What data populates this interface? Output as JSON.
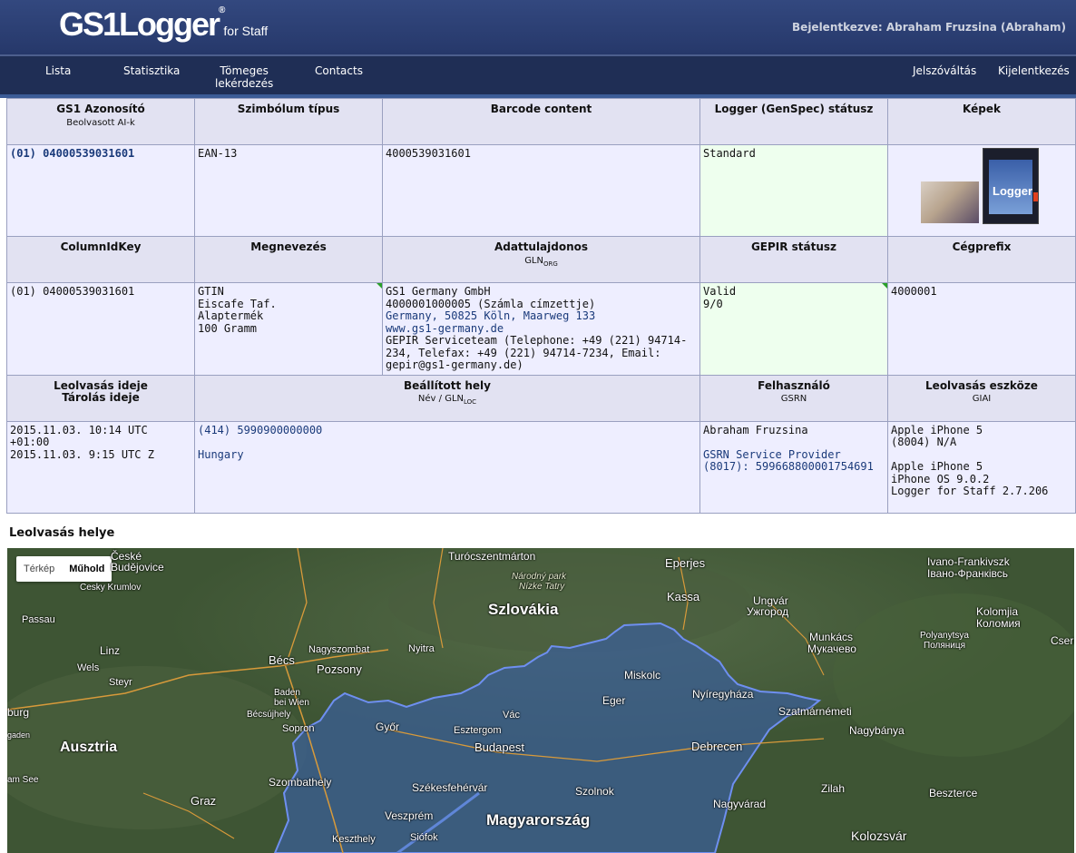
{
  "header": {
    "logo_main": "GS1Logger",
    "logo_reg": "®",
    "logo_sub": "for Staff",
    "user_text": "Bejelentkezve: Abraham Fruzsina (Abraham)"
  },
  "nav": {
    "lista": "Lista",
    "statisztika": "Statisztika",
    "tomeges_1": "Tömeges",
    "tomeges_2": "lekérdezés",
    "contacts": "Contacts",
    "jelszo": "Jelszóváltás",
    "kijelentkezes": "Kijelentkezés"
  },
  "table": {
    "h1": {
      "gs1": "GS1 Azonosító",
      "gs1_sub": "Beolvasott AI-k",
      "szimbolum": "Szimbólum típus",
      "barcode": "Barcode content",
      "logger": "Logger (GenSpec) státusz",
      "kepek": "Képek"
    },
    "r1": {
      "gs1": "(01) 04000539031601",
      "szimbolum": "EAN-13",
      "barcode": "4000539031601",
      "logger": "Standard"
    },
    "h2": {
      "columnid": "ColumnIdKey",
      "megnevezes": "Megnevezés",
      "adattulajdonos": "Adattulajdonos",
      "gln": "GLN",
      "gln_sub": "ORG",
      "gepir": "GEPIR státusz",
      "cegprefix": "Cégprefix"
    },
    "r2": {
      "columnid": "(01) 04000539031601",
      "megnevezes": [
        "GTIN",
        "Eiscafe Taf.",
        "Alaptermék",
        "100 Gramm"
      ],
      "owner_name": "GS1 Germany GmbH",
      "owner_gln": "4000001000005 (Számla címzettje)",
      "owner_addr": "Germany, 50825 Köln, Maarweg 133",
      "owner_web": "www.gs1-germany.de",
      "owner_contact": "GEPIR Serviceteam (Telephone: +49 (221) 94714-234, Telefax: +49 (221) 94714-7234, Email: gepir@gs1-germany.de)",
      "gepir": [
        "Valid",
        "9/0"
      ],
      "cegprefix": "4000001"
    },
    "h3": {
      "leolvasas_ideje": "Leolvasás ideje",
      "tarolas_ideje": "Tárolás ideje",
      "hely": "Beállított hely",
      "hely_sub": "Név / GLN",
      "hely_sub2": "LOC",
      "felhasznalo": "Felhasználó",
      "felhasznalo_sub": "GSRN",
      "eszkoz": "Leolvasás eszköze",
      "eszkoz_sub": "GIAI"
    },
    "r3": {
      "leolvasas": "2015.11.03. 10:14 UTC +01:00",
      "tarolas": "2015.11.03. 9:15 UTC Z",
      "hely_gln": "(414) 5990900000000",
      "hely_nev": "Hungary",
      "felhasznalo": "Abraham Fruzsina",
      "gsrn": "GSRN Service Provider (8017): 599668800001754691",
      "eszkoz": [
        "Apple iPhone 5",
        "(8004) N/A",
        "",
        "Apple iPhone 5",
        "iPhone OS 9.0.2",
        "Logger for Staff 2.7.206"
      ]
    },
    "thumb_text": "Logger"
  },
  "section": {
    "title": "Leolvasás helye"
  },
  "map": {
    "btn_map": "Térkép",
    "btn_sat": "Műhold",
    "labels": {
      "ceske_1": "České",
      "ceske_2": "Budějovice",
      "cesky": "Cesky Krumlov",
      "passau": "Passau",
      "linz": "Linz",
      "wels": "Wels",
      "steyr": "Steyr",
      "burg": "burg",
      "gaden": "gaden",
      "ausztria": "Ausztria",
      "amsee": "am See",
      "becs": "Bécs",
      "baden": "Baden",
      "beiwien": "bei Wien",
      "becsujhely": "Bécsújhely",
      "sopron": "Sopron",
      "szombathely": "Szombathely",
      "graz": "Graz",
      "pozsony": "Pozsony",
      "nagyszombat": "Nagyszombat",
      "nyitra": "Nyitra",
      "gyor": "Győr",
      "esztergom": "Esztergom",
      "vac": "Vác",
      "budapest": "Budapest",
      "szekesfehervar": "Székesfehérvár",
      "veszprem": "Veszprém",
      "siofok": "Siófok",
      "keszthely": "Keszthely",
      "turocszentmarton": "Turócszentmárton",
      "narodny": "Národný park",
      "nizke": "Nízke Tatry",
      "szlovakia": "Szlovákia",
      "eperjes": "Eperjes",
      "kassa": "Kassa",
      "miskolc": "Miskolc",
      "eger": "Eger",
      "nyiregyhaza": "Nyíregyháza",
      "debrecen": "Debrecen",
      "szolnok": "Szolnok",
      "magyarorszag": "Magyarország",
      "szatmarnemeti": "Szatmárnémeti",
      "nagybanya": "Nagybánya",
      "zilah": "Zilah",
      "nagyvarad": "Nagyvárad",
      "kolozsvar": "Kolozsvár",
      "beszterce": "Beszterce",
      "ungvar_1": "Ungvár",
      "ungvar_2": "Ужгород",
      "munkacs_1": "Munkács",
      "munkacs_2": "Мукачево",
      "polyany_1": "Polyanytsya",
      "polyany_2": "Поляниця",
      "ivano_1": "Ivano-Frankivszk",
      "ivano_2": "Івано-Франківсь",
      "kolomija_1": "Kolomjia",
      "kolomija_2": "Коломия",
      "cserno": "Cserr"
    }
  }
}
